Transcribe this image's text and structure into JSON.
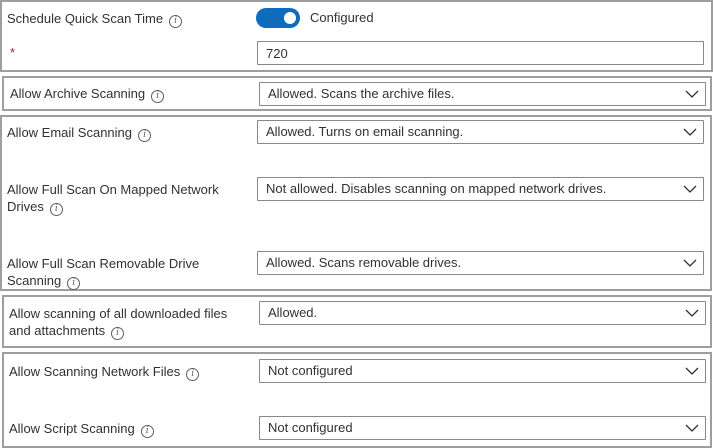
{
  "schedule_quick_scan": {
    "label": "Schedule Quick Scan Time",
    "toggle_state": "Configured",
    "required_marker": "*",
    "value": "720"
  },
  "settings": [
    {
      "label": "Allow Archive Scanning",
      "value": "Allowed. Scans the archive files."
    },
    {
      "label": "Allow Email Scanning",
      "value": "Allowed. Turns on email scanning."
    },
    {
      "label_line1": "Allow Full Scan On Mapped Network",
      "label_line2": "Drives",
      "value": "Not allowed. Disables scanning on mapped network drives."
    },
    {
      "label_line1": "Allow Full Scan Removable Drive",
      "label_line2": "Scanning",
      "value": "Allowed. Scans removable drives."
    },
    {
      "label_line1": "Allow scanning of all downloaded files",
      "label_line2": "and attachments",
      "value": "Allowed."
    },
    {
      "label": "Allow Scanning Network Files",
      "value": "Not configured"
    },
    {
      "label": "Allow Script Scanning",
      "value": "Not configured"
    }
  ],
  "icons": {
    "info": "info-icon",
    "dropdown": "chevron-down-icon"
  },
  "colors": {
    "toggle_on": "#0f6cbd",
    "required": "#a4262c",
    "border": "#9e9e9e"
  }
}
